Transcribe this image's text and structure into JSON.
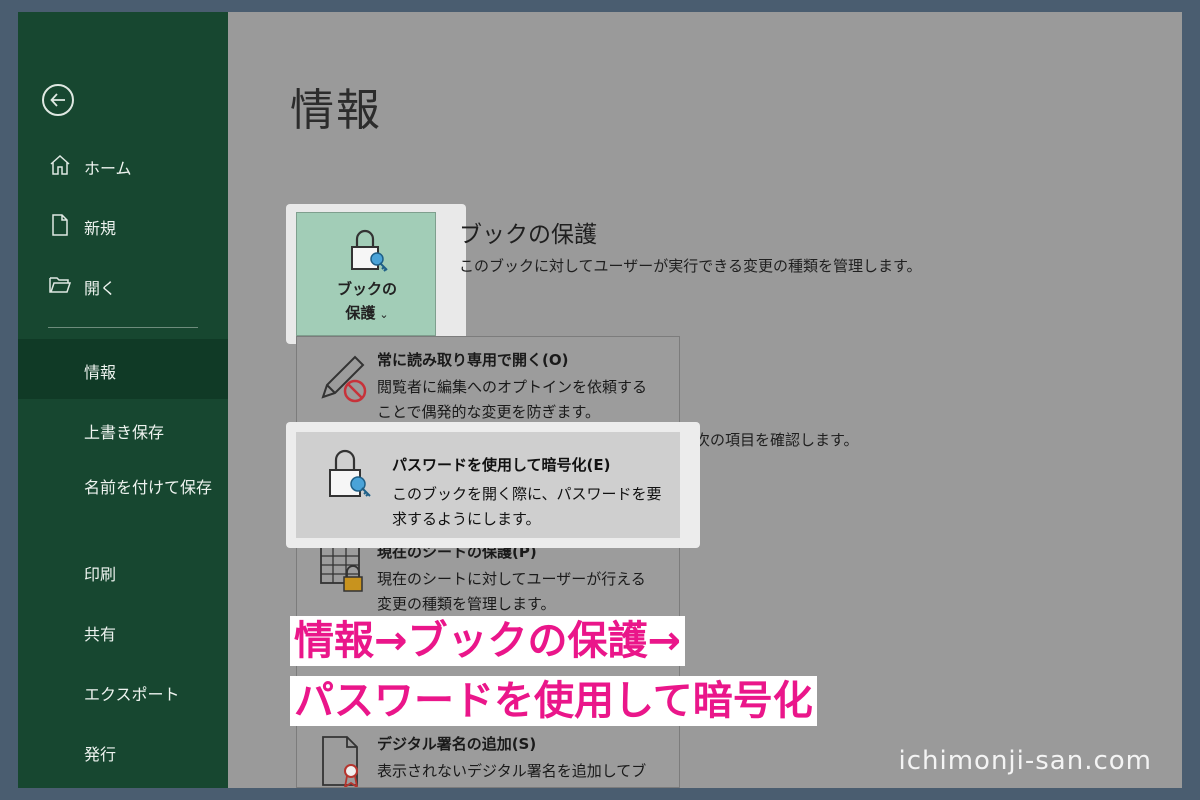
{
  "sidebar": {
    "back_icon": "arrow-left-icon",
    "items": [
      {
        "label": "ホーム",
        "icon": "home-icon"
      },
      {
        "label": "新規",
        "icon": "new-document-icon"
      },
      {
        "label": "開く",
        "icon": "folder-open-icon"
      },
      {
        "label": "情報"
      },
      {
        "label": "上書き保存"
      },
      {
        "label": "名前を付けて保存"
      },
      {
        "label": "印刷"
      },
      {
        "label": "共有"
      },
      {
        "label": "エクスポート"
      },
      {
        "label": "発行"
      }
    ]
  },
  "main": {
    "title": "情報",
    "protect": {
      "button_line1": "ブックの",
      "button_line2": "保護",
      "button_chevron": "⌄",
      "section_title": "ブックの保護",
      "section_desc": "このブックに対してユーザーが実行できる変更の種類を管理します。"
    },
    "behind_text": "の次の項目を確認します。",
    "dropdown": [
      {
        "title": "常に読み取り専用で開く(O)",
        "desc": "閲覧者に編集へのオプトインを依頼することで偶発的な変更を防ぎます。",
        "icon": "pencil-no-icon"
      },
      {
        "title": "パスワードを使用して暗号化(E)",
        "desc": "このブックを開く際に、パスワードを要求するようにします。",
        "icon": "lock-key-icon"
      },
      {
        "title": "現在のシートの保護(P)",
        "desc": "現在のシートに対してユーザーが行える変更の種類を管理します。",
        "icon": "sheet-lock-icon"
      },
      {
        "title": "デジタル署名の追加(S)",
        "desc": "表示されないデジタル署名を追加してブックの完全性を確保します。",
        "icon": "document-ribbon-icon"
      }
    ]
  },
  "overlay": {
    "caption_line1": "情報→ブックの保護→",
    "caption_line2": "パスワードを使用して暗号化",
    "color": "#ea168a"
  },
  "watermark": "ichimonji-san.com"
}
